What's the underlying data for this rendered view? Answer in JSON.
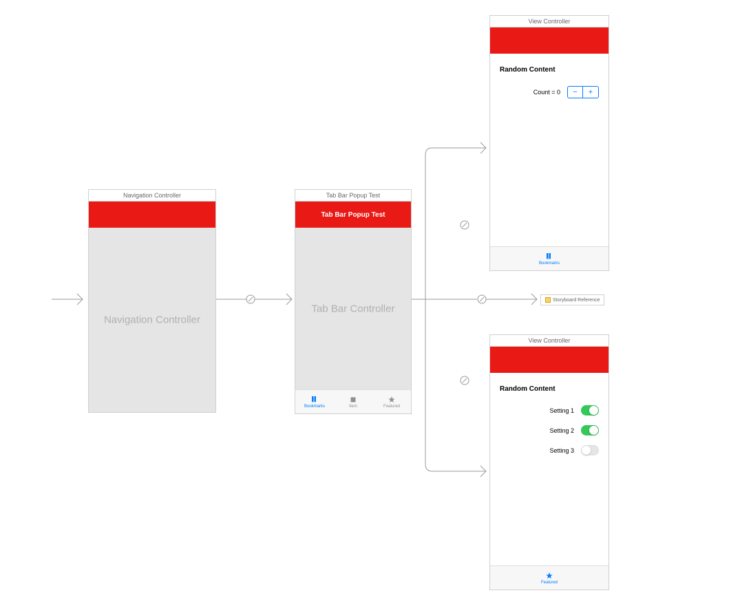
{
  "scenes": {
    "nav": {
      "title": "Navigation Controller",
      "placeholder": "Navigation Controller"
    },
    "tabbar": {
      "title": "Tab Bar Popup Test",
      "nav_title": "Tab Bar Popup Test",
      "placeholder": "Tab Bar Controller",
      "tabs": {
        "bookmarks": "Bookmarks",
        "item": "Item",
        "featured": "Featured"
      }
    },
    "vc1": {
      "title": "View Controller",
      "section": "Random Content",
      "count_label": "Count = 0",
      "tab": "Bookmarks"
    },
    "vc2": {
      "title": "View Controller",
      "section": "Random Content",
      "settings": {
        "s1": {
          "label": "Setting 1",
          "on": true
        },
        "s2": {
          "label": "Setting 2",
          "on": true
        },
        "s3": {
          "label": "Setting 3",
          "on": false
        }
      },
      "tab": "Featured"
    },
    "ref": {
      "label": "Storyboard Reference"
    }
  },
  "stepper": {
    "minus": "−",
    "plus": "+"
  }
}
